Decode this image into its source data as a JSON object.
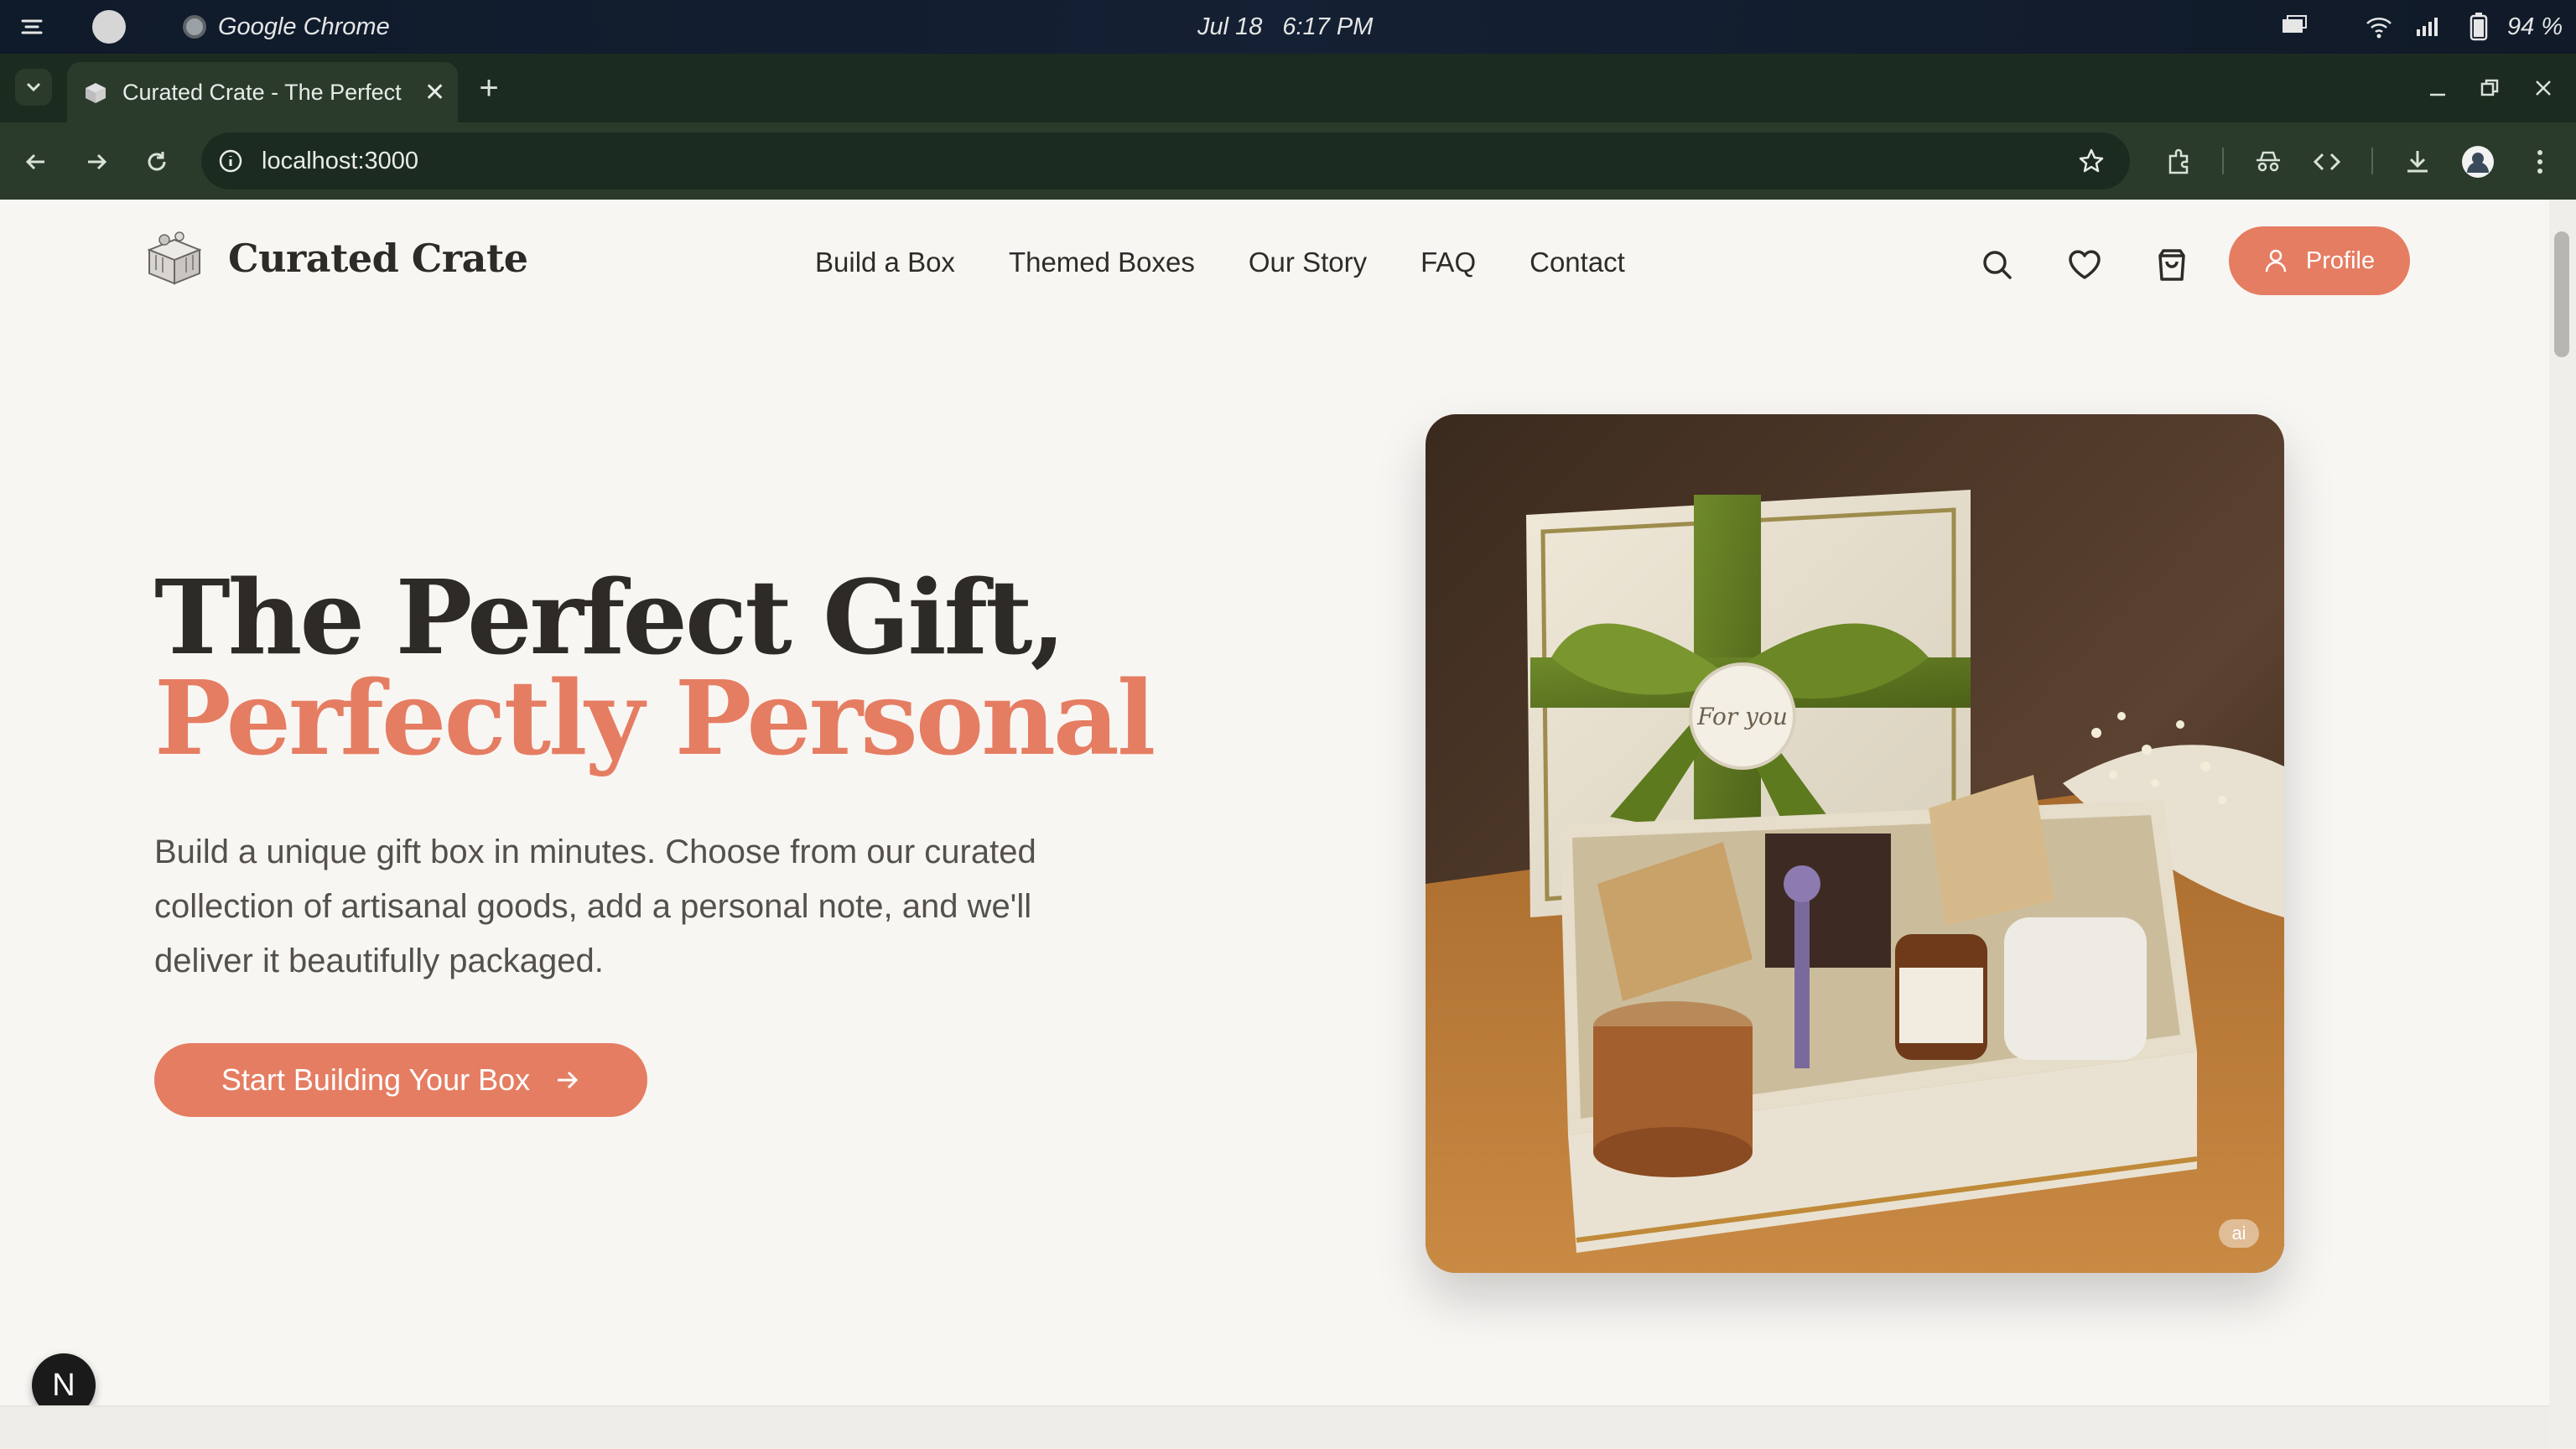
{
  "os": {
    "app_name": "Google Chrome",
    "date": "Jul 18",
    "time": "6:17 PM",
    "battery": "94 %"
  },
  "browser": {
    "tab_title": "Curated Crate - The Perfect Gift, Perfectly Personal",
    "url": "localhost:3000"
  },
  "site": {
    "brand": "Curated Crate",
    "nav": [
      "Build a Box",
      "Themed Boxes",
      "Our Story",
      "FAQ",
      "Contact"
    ],
    "profile_label": "Profile"
  },
  "hero": {
    "title_line1": "The Perfect Gift,",
    "title_line2": "Perfectly Personal",
    "description": "Build a unique gift box in minutes. Choose from our curated collection of artisanal goods, add a personal note, and we'll deliver it beautifully packaged.",
    "cta_label": "Start Building Your Box",
    "image_badge": "ai",
    "tag_text": "For you"
  },
  "dev": {
    "next_badge": "N"
  },
  "colors": {
    "accent": "#e57d62",
    "heading": "#2e2a27",
    "background": "#f8f6f3",
    "browser_frame": "#2a3b2c"
  }
}
